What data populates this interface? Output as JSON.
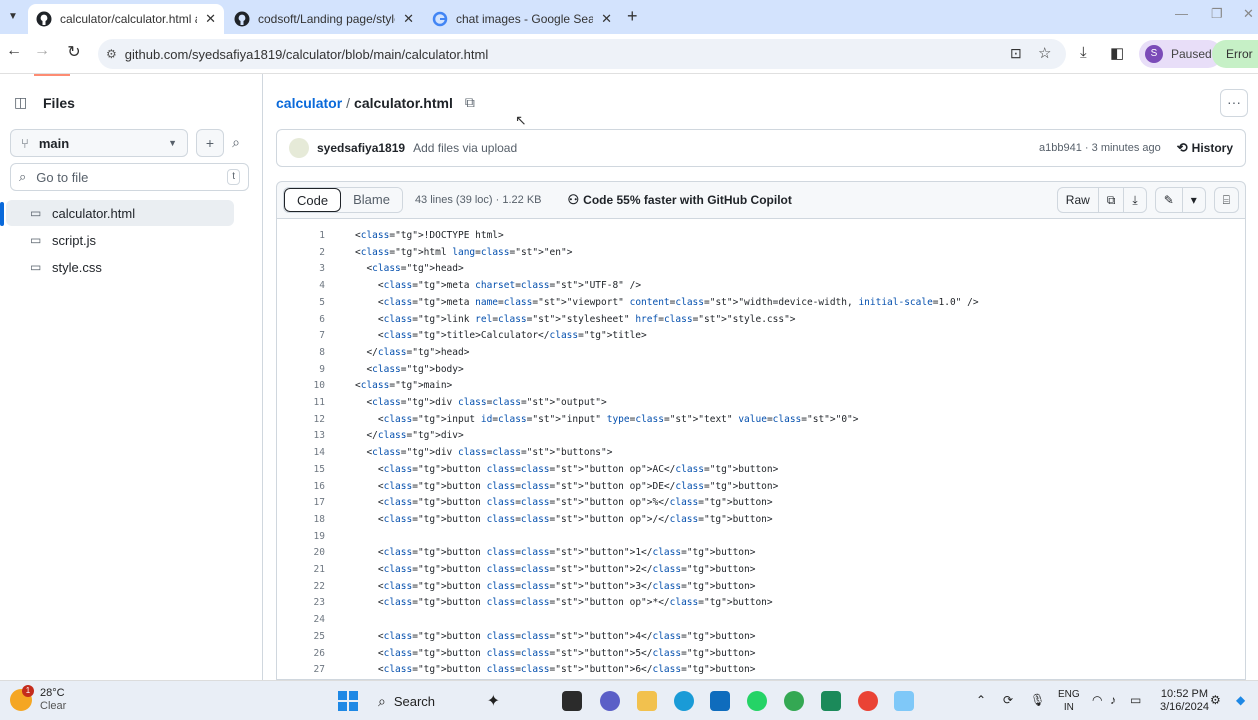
{
  "browser": {
    "tabs": [
      {
        "title": "calculator/calculator.html at m",
        "active": true
      },
      {
        "title": "codsoft/Landing page/styles.cs",
        "active": false
      },
      {
        "title": "chat images - Google Search",
        "active": false
      }
    ],
    "url": "github.com/syedsafiya1819/calculator/blob/main/calculator.html",
    "profile_initial": "S",
    "profile_status": "Paused",
    "error_label": "Error"
  },
  "sidebar": {
    "title": "Files",
    "branch": "main",
    "search_placeholder": "Go to file",
    "search_shortcut": "t",
    "files": [
      {
        "name": "calculator.html",
        "selected": true
      },
      {
        "name": "script.js",
        "selected": false
      },
      {
        "name": "style.css",
        "selected": false
      }
    ]
  },
  "breadcrumb": {
    "repo": "calculator",
    "separator": "/",
    "file": "calculator.html"
  },
  "commit": {
    "author": "syedsafiya1819",
    "message": "Add files via upload",
    "sha_time": "a1bb941 · 3 minutes ago",
    "history_label": "History"
  },
  "file_header": {
    "code_label": "Code",
    "blame_label": "Blame",
    "meta": "43 lines (39 loc) · 1.22 KB",
    "copilot": "Code 55% faster with GitHub Copilot",
    "raw_label": "Raw"
  },
  "code_lines": [
    {
      "n": "1",
      "t": "<!DOCTYPE html>"
    },
    {
      "n": "2",
      "t": "<html lang=\"en\">"
    },
    {
      "n": "3",
      "t": "  <head>"
    },
    {
      "n": "4",
      "t": "    <meta charset=\"UTF-8\" />"
    },
    {
      "n": "5",
      "t": "    <meta name=\"viewport\" content=\"width=device-width, initial-scale=1.0\" />"
    },
    {
      "n": "6",
      "t": "    <link rel=\"stylesheet\" href=\"style.css\">"
    },
    {
      "n": "7",
      "t": "    <title>Calculator</title>"
    },
    {
      "n": "8",
      "t": "  </head>"
    },
    {
      "n": "9",
      "t": "  <body>"
    },
    {
      "n": "10",
      "t": "<main>"
    },
    {
      "n": "11",
      "t": "  <div class=\"output\">"
    },
    {
      "n": "12",
      "t": "    <input id=\"input\" type=\"text\" value=\"0\">"
    },
    {
      "n": "13",
      "t": "  </div>"
    },
    {
      "n": "14",
      "t": "  <div class=\"buttons\">"
    },
    {
      "n": "15",
      "t": "    <button class=\"button op\">AC</button>"
    },
    {
      "n": "16",
      "t": "    <button class=\"button op\">DE</button>"
    },
    {
      "n": "17",
      "t": "    <button class=\"button op\">%</button>"
    },
    {
      "n": "18",
      "t": "    <button class=\"button op\">/</button>"
    },
    {
      "n": "19",
      "t": ""
    },
    {
      "n": "20",
      "t": "    <button class=\"button\">1</button>"
    },
    {
      "n": "21",
      "t": "    <button class=\"button\">2</button>"
    },
    {
      "n": "22",
      "t": "    <button class=\"button\">3</button>"
    },
    {
      "n": "23",
      "t": "    <button class=\"button op\">*</button>"
    },
    {
      "n": "24",
      "t": ""
    },
    {
      "n": "25",
      "t": "    <button class=\"button\">4</button>"
    },
    {
      "n": "26",
      "t": "    <button class=\"button\">5</button>"
    },
    {
      "n": "27",
      "t": "    <button class=\"button\">6</button>"
    }
  ],
  "taskbar": {
    "temperature": "28°C",
    "condition": "Clear",
    "weather_badge": "1",
    "search_label": "Search",
    "lang_top": "ENG",
    "lang_bottom": "IN",
    "time": "10:52 PM",
    "date": "3/16/2024"
  }
}
